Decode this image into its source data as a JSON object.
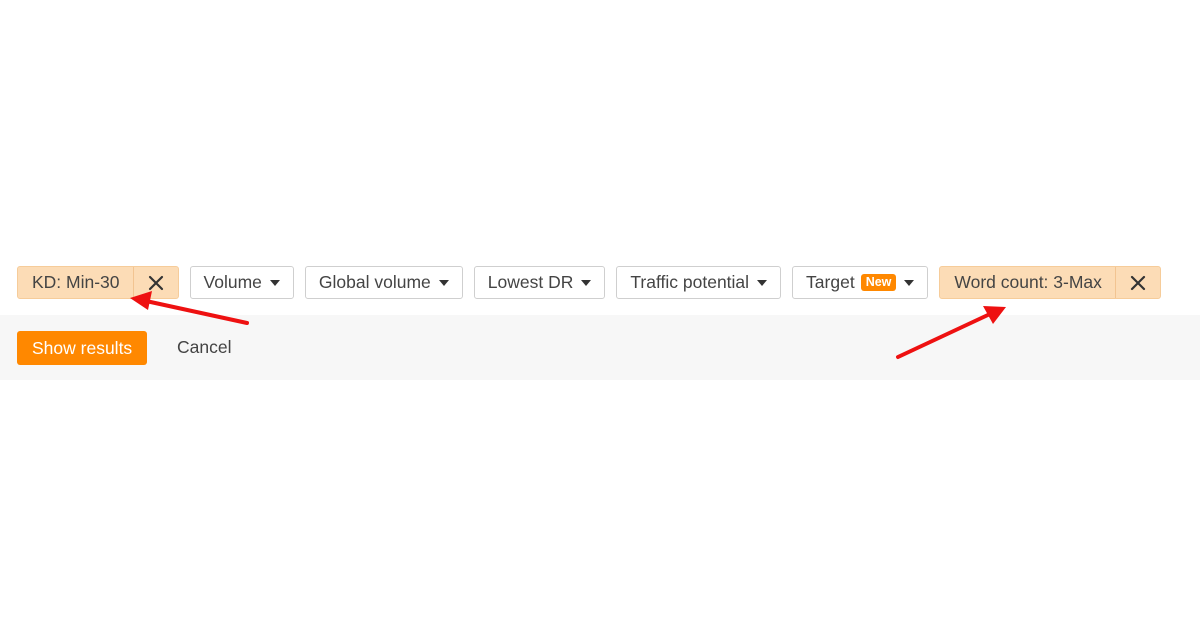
{
  "filters": {
    "active_chips": [
      {
        "label": "KD: Min-30",
        "close_icon": "close-icon"
      },
      {
        "label": "Word count: 3-Max",
        "close_icon": "close-icon"
      }
    ],
    "dropdowns": [
      {
        "label": "Volume"
      },
      {
        "label": "Global volume"
      },
      {
        "label": "Lowest DR"
      },
      {
        "label": "Traffic potential"
      },
      {
        "label": "Target",
        "badge": "New"
      }
    ]
  },
  "actions": {
    "show_results_label": "Show results",
    "cancel_label": "Cancel"
  },
  "colors": {
    "accent": "#ff8800",
    "chip_bg": "#fcdcb6",
    "annotation_arrow": "#ee1111",
    "panel_bg": "#f7f7f7"
  },
  "annotations": [
    {
      "type": "arrow",
      "points_to": "KD: Min-30 filter"
    },
    {
      "type": "arrow",
      "points_to": "Word count: 3-Max filter"
    }
  ]
}
